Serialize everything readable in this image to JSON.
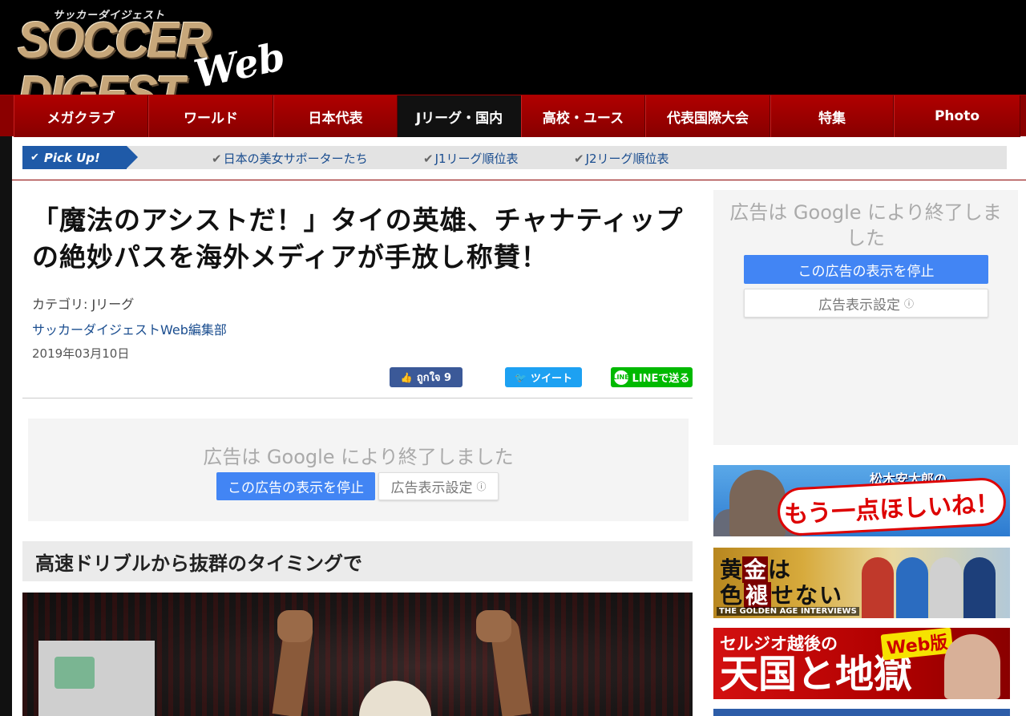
{
  "site": {
    "logo_kana": "サッカーダイジェスト",
    "logo_main": "SOCCER DIGEST",
    "logo_web": "Web"
  },
  "nav": {
    "items": [
      {
        "label": "メガクラブ",
        "active": false
      },
      {
        "label": "ワールド",
        "active": false
      },
      {
        "label": "日本代表",
        "active": false
      },
      {
        "label": "Jリーグ・国内",
        "active": true
      },
      {
        "label": "高校・ユース",
        "active": false
      },
      {
        "label": "代表国際大会",
        "active": false
      },
      {
        "label": "特集",
        "active": false
      },
      {
        "label": "Photo",
        "active": false
      }
    ]
  },
  "pickup": {
    "tag": "Pick Up!",
    "links": [
      "日本の美女サポーターたち",
      "J1リーグ順位表",
      "J2リーグ順位表"
    ]
  },
  "article": {
    "title": "「魔法のアシストだ！」タイの英雄、チャナティップの絶妙パスを海外メディアが手放し称賛！",
    "category": "カテゴリ: Jリーグ",
    "author": "サッカーダイジェストWeb編集部",
    "date": "2019年03月10日",
    "subheading": "高速ドリブルから抜群のタイミングで"
  },
  "share": {
    "facebook": "ถูกใจ 9",
    "twitter": "ツイート",
    "line": "LINEで送る"
  },
  "ad_main": {
    "text": "広告は Google により終了しました",
    "stop_button": "この広告の表示を停止",
    "settings_button": "広告表示設定"
  },
  "ad_side": {
    "text": "広告は Google により終了しました",
    "stop_button": "この広告の表示を停止",
    "settings_button": "広告表示設定"
  },
  "banners": {
    "b1_name": "松木安太郎の",
    "b1_catch": "もう一点ほしいね！",
    "b2_line1a": "黄",
    "b2_line1b": "金",
    "b2_line1c": "は",
    "b2_line2a": "色",
    "b2_line2b": "褪",
    "b2_line2c": "せない",
    "b2_sub": "THE GOLDEN AGE INTERVIEWS",
    "b3_line1": "セルジオ越後の",
    "b3_line2": "天国と地獄",
    "b3_badge": "Web版"
  },
  "colors": {
    "nav_red": "#8b0000",
    "nav_active": "#111111",
    "pickup_blue": "#1f5aa8",
    "link_blue": "#1a4d8f",
    "facebook": "#3b5998",
    "twitter": "#1da1f2",
    "line": "#00b900",
    "google_blue": "#4285f4"
  }
}
